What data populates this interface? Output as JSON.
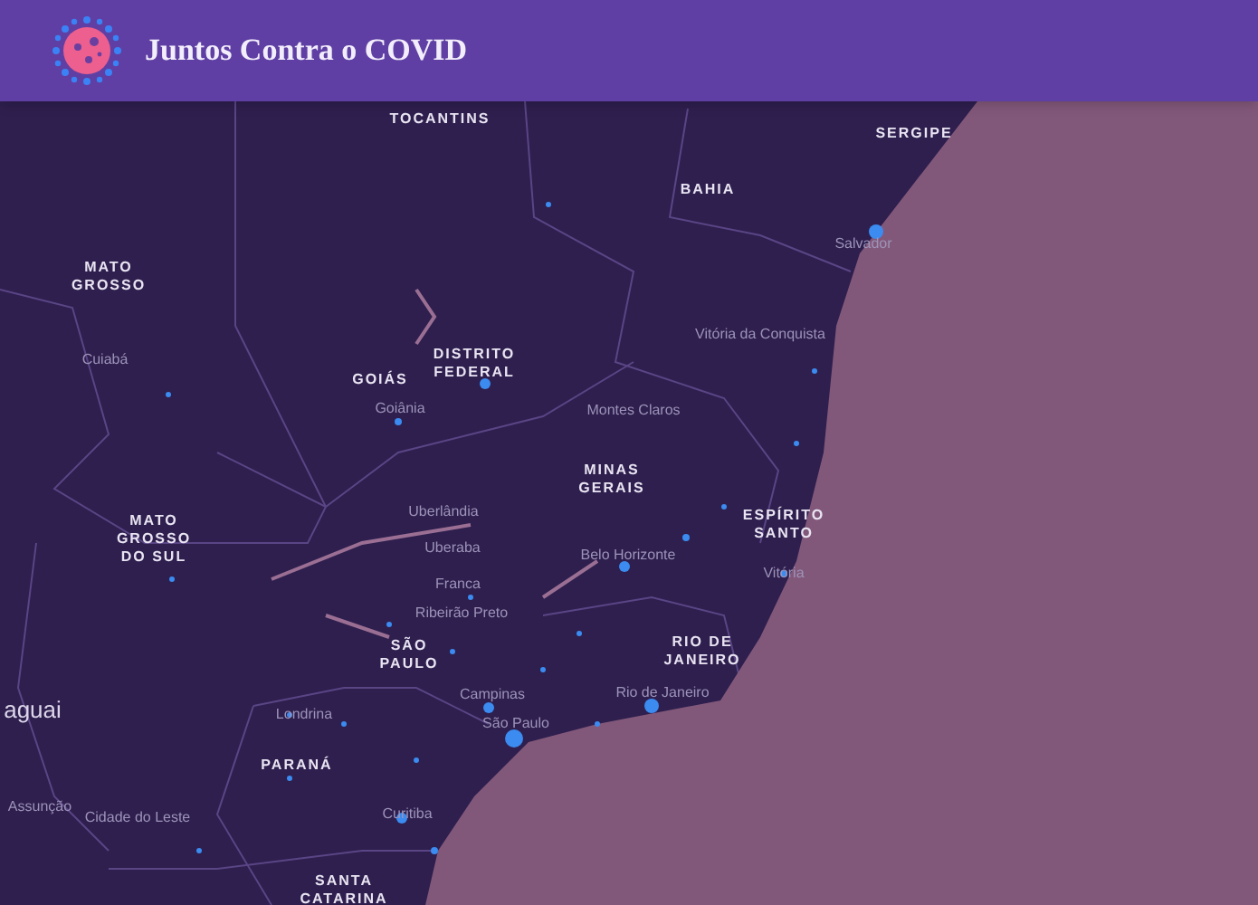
{
  "header": {
    "title": "Juntos Contra o COVID"
  },
  "map": {
    "state_labels": [
      "TOCANTINS",
      "SERGIPE",
      "BAHIA",
      "MATO GROSSO",
      "DISTRITO FEDERAL",
      "GOIÁS",
      "MINAS GERAIS",
      "ESPÍRITO SANTO",
      "MATO GROSSO DO SUL",
      "SÃO PAULO",
      "RIO DE JANEIRO",
      "PARANÁ",
      "SANTA CATARINA"
    ],
    "city_labels": [
      "Salvador",
      "Vitória da Conquista",
      "Cuiabá",
      "Goiânia",
      "Montes Claros",
      "Uberlândia",
      "Uberaba",
      "Belo Horizonte",
      "Franca",
      "Ribeirão Preto",
      "Vitória",
      "Campinas",
      "Rio de Janeiro",
      "Londrina",
      "São Paulo",
      "Assunção",
      "Cidade do Leste",
      "Curitiba"
    ],
    "country_labels": [
      "aguai"
    ]
  }
}
